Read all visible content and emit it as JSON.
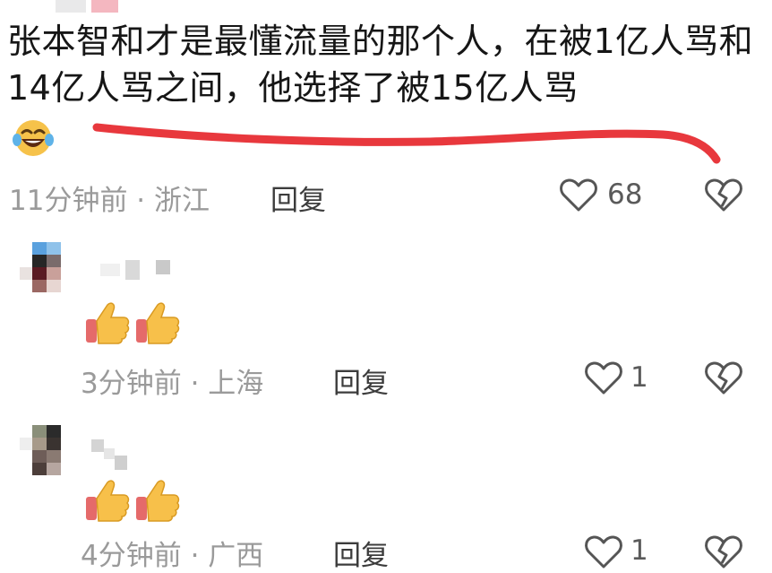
{
  "comments": [
    {
      "text": "张本智和才是最懂流量的那个人，在被1亿人骂和14亿人骂之间，他选择了被15亿人骂",
      "meta": "11分钟前 · 浙江",
      "reply_label": "回复",
      "like_count": "68"
    },
    {
      "meta": "3分钟前 · 上海",
      "reply_label": "回复",
      "like_count": "1"
    },
    {
      "meta": "4分钟前 · 广西",
      "reply_label": "回复",
      "like_count": "1"
    }
  ],
  "icons": {
    "like": "heart-icon",
    "dislike": "broken-heart-icon",
    "laugh": "laughing-tears-emoji",
    "thumbs": "thumbs-up-emoji"
  },
  "colors": {
    "underline": "#e8383d",
    "meta": "#9a9a9a",
    "icon": "#555555"
  }
}
